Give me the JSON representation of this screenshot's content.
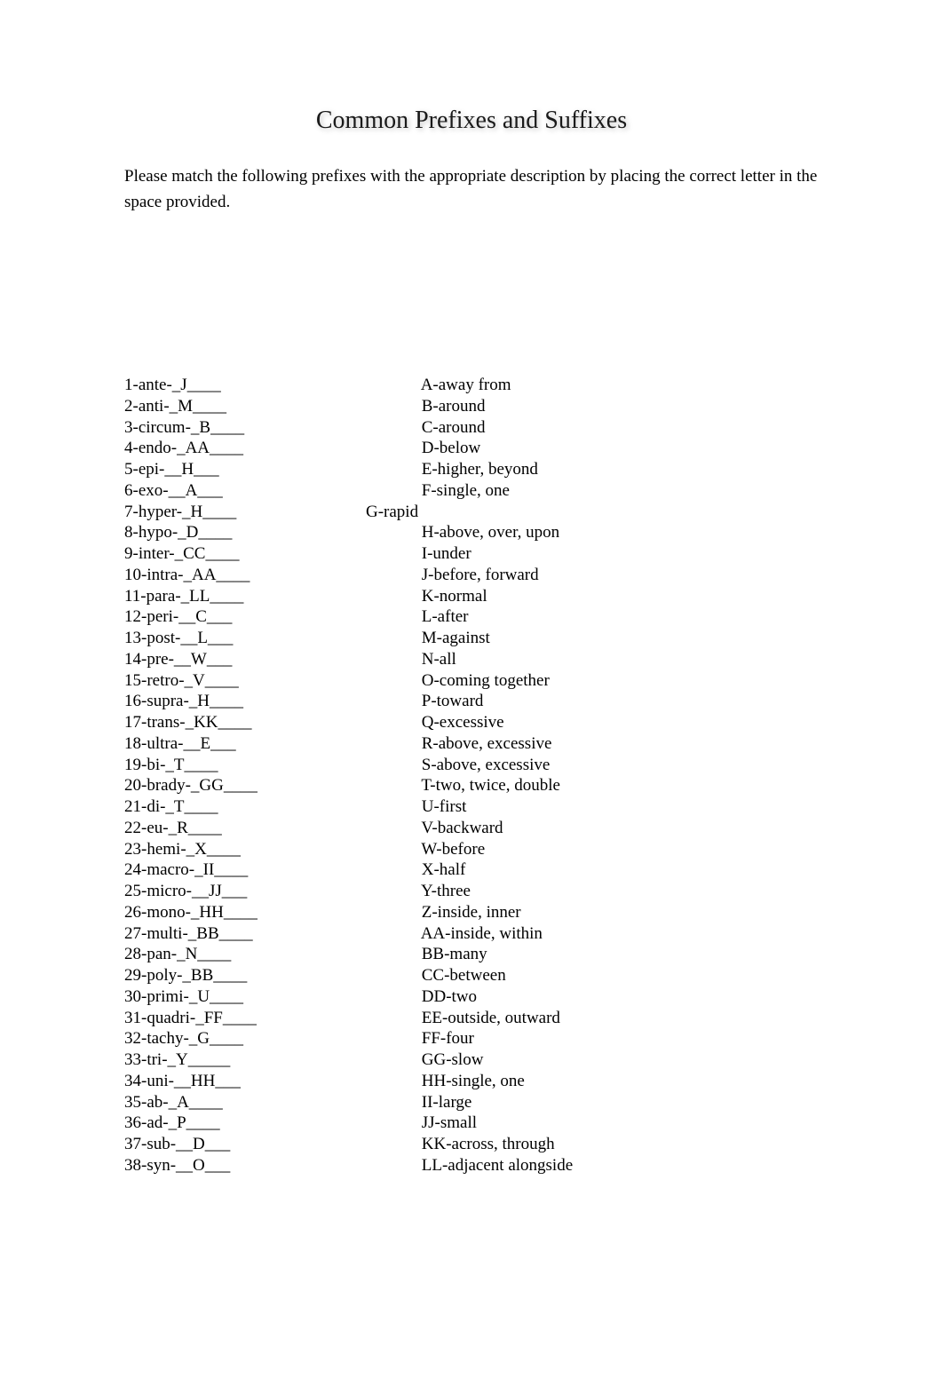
{
  "title": "Common Prefixes and Suffixes",
  "instructions": "Please match the following prefixes with the appropriate description by placing the correct letter in the space provided.",
  "left_items": [
    "1-ante-_J____",
    "2-anti-_M____",
    "3-circum-_B____",
    "4-endo-_AA____",
    "5-epi-__H___",
    "6-exo-__A___",
    "7-hyper-_H____",
    "8-hypo-_D____",
    "9-inter-_CC____",
    "10-intra-_AA____",
    "11-para-_LL____",
    "12-peri-__C___",
    "13-post-__L___",
    "14-pre-__W___",
    "15-retro-_V____",
    "16-supra-_H____",
    "17-trans-_KK____",
    "18-ultra-__E___",
    "19-bi-_T____",
    "20-brady-_GG____",
    "21-di-_T____",
    "22-eu-_R____",
    "23-hemi-_X____",
    "24-macro-_II____",
    "25-micro-__JJ___",
    "26-mono-_HH____",
    "27-multi-_BB____",
    "28-pan-_N____",
    "29-poly-_BB____",
    "30-primi-_U____",
    "31-quadri-_FF____",
    "32-tachy-_G____",
    "33-tri-_Y_____",
    "34-uni-__HH___",
    "35-ab-_A____",
    "36-ad-_P____",
    "37-sub-__D___",
    "38-syn-__O___"
  ],
  "right_items": [
    " A-away from",
    " B-around",
    " C-around",
    " D-below",
    " E-higher, beyond",
    " F-single, one",
    "G-rapid",
    " H-above, over, upon",
    " I-under",
    " J-before, forward",
    " K-normal",
    " L-after",
    " M-against",
    " N-all",
    " O-coming together",
    " P-toward",
    " Q-excessive",
    " R-above, excessive",
    " S-above, excessive",
    " T-two, twice, double",
    " U-first",
    " V-backward",
    " W-before",
    " X-half",
    " Y-three",
    " Z-inside, inner",
    " AA-inside, within",
    " BB-many",
    " CC-between",
    " DD-two",
    " EE-outside, outward",
    " FF-four",
    " GG-slow",
    " HH-single, one",
    " II-large",
    " JJ-small",
    " KK-across, through",
    " LL-adjacent alongside"
  ]
}
